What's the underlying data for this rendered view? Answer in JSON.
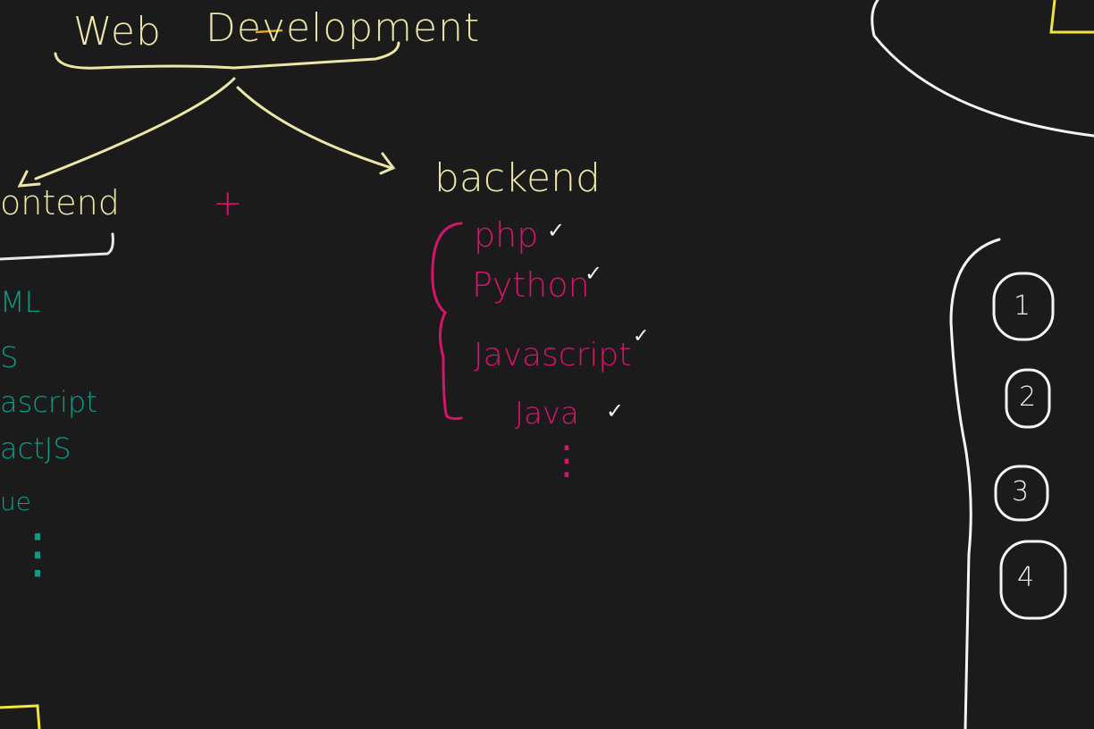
{
  "title": {
    "word1": "Web",
    "word2": "Development"
  },
  "frontend": {
    "heading": "ontend",
    "items": [
      "ML",
      "S",
      "ascript",
      "actJS",
      "ue"
    ],
    "ellipsis": "⋮"
  },
  "plus_sign": "+",
  "backend": {
    "heading": "backend",
    "items": [
      "php",
      "Python",
      "Javascript",
      "Java"
    ],
    "ellipsis": "⋮",
    "check": "✓"
  },
  "numbered_list": [
    "1",
    "2",
    "3",
    "4"
  ],
  "colors": {
    "background": "#1b1b1c",
    "title": "#ece7a6",
    "backend_items": "#d8136e",
    "frontend_items": "#0e9c86",
    "marks": "#f4f4f4",
    "yellow_box": "#f2e43a"
  }
}
